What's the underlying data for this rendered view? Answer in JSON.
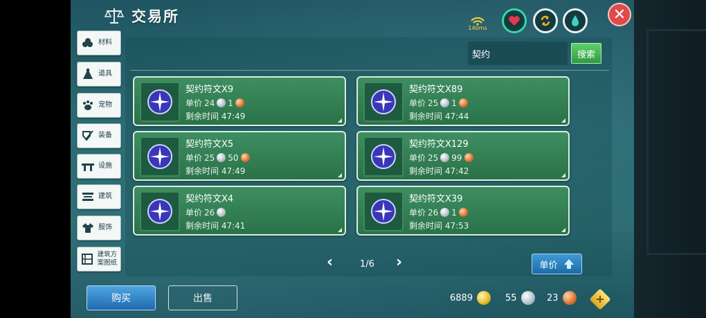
{
  "header": {
    "title": "交易所",
    "ping": "140ms"
  },
  "sidebar": {
    "items": [
      {
        "label": "材料",
        "icon": "materials-icon"
      },
      {
        "label": "道具",
        "icon": "flask-icon"
      },
      {
        "label": "宠物",
        "icon": "paw-icon"
      },
      {
        "label": "装备",
        "icon": "equipment-icon"
      },
      {
        "label": "设施",
        "icon": "facility-icon"
      },
      {
        "label": "建筑",
        "icon": "building-icon"
      },
      {
        "label": "服饰",
        "icon": "clothing-icon"
      },
      {
        "label": "建筑方案图纸",
        "icon": "blueprint-icon"
      }
    ]
  },
  "search": {
    "value": "契约",
    "button_label": "搜索"
  },
  "listings": [
    {
      "name": "契约符文X9",
      "price_label": "单价",
      "silver": "24",
      "bronze": "1",
      "time_label": "剩余时间",
      "time": "47:49"
    },
    {
      "name": "契约符文X89",
      "price_label": "单价",
      "silver": "25",
      "bronze": "1",
      "time_label": "剩余时间",
      "time": "47:44"
    },
    {
      "name": "契约符文X5",
      "price_label": "单价",
      "silver": "25",
      "bronze": "50",
      "time_label": "剩余时间",
      "time": "47:49"
    },
    {
      "name": "契约符文X129",
      "price_label": "单价",
      "silver": "25",
      "bronze": "99",
      "time_label": "剩余时间",
      "time": "47:42"
    },
    {
      "name": "契约符文X4",
      "price_label": "单价",
      "silver": "26",
      "bronze": "",
      "time_label": "剩余时间",
      "time": "47:41"
    },
    {
      "name": "契约符文X39",
      "price_label": "单价",
      "silver": "26",
      "bronze": "1",
      "time_label": "剩余时间",
      "time": "47:53"
    }
  ],
  "pager": {
    "text": "1/6"
  },
  "sort": {
    "label": "单价"
  },
  "actions": {
    "buy_label": "购买",
    "sell_label": "出售"
  },
  "wallet": {
    "gold": "6889",
    "silver": "55",
    "bronze": "23"
  },
  "colors": {
    "accent_green": "#3e8e62",
    "button_blue": "#1f6ab0",
    "close_red": "#e04a4a"
  }
}
